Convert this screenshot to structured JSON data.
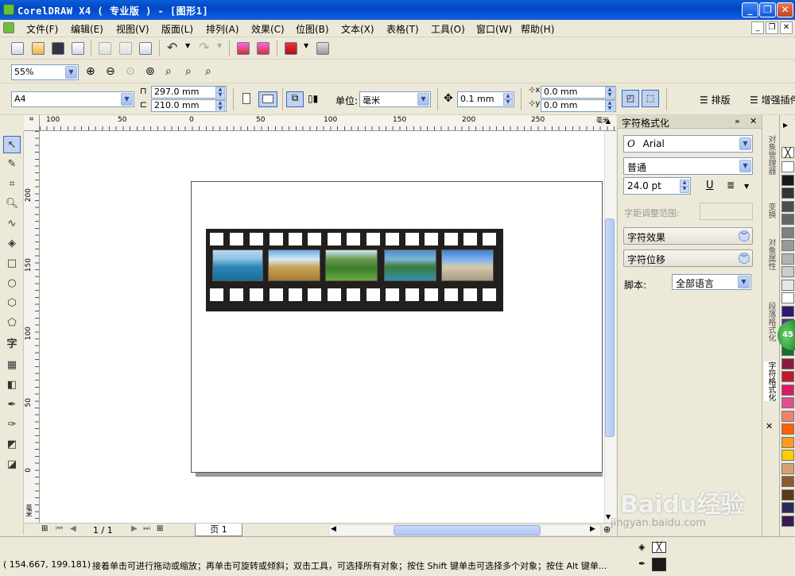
{
  "window": {
    "title": "CorelDRAW X4 ( 专业版 ) - [图形1]",
    "minimize": "_",
    "restore": "❐",
    "close": "✕"
  },
  "menu": {
    "items": [
      "文件(F)",
      "编辑(E)",
      "视图(V)",
      "版面(L)",
      "排列(A)",
      "效果(C)",
      "位图(B)",
      "文本(X)",
      "表格(T)",
      "工具(O)",
      "窗口(W)",
      "帮助(H)"
    ],
    "doc_controls": [
      "_",
      "❐",
      "✕"
    ]
  },
  "zoombar": {
    "zoom_value": "55%"
  },
  "propertybar": {
    "page_size": "A4",
    "width": "297.0 mm",
    "height": "210.0 mm",
    "unit_label": "单位:",
    "unit_value": "毫米",
    "nudge": "0.1 mm",
    "dup_x": "0.0 mm",
    "dup_y": "0.0 mm",
    "layout_label": "排版",
    "enhance_label": "增强插件"
  },
  "ruler": {
    "h_ticks": [
      "100",
      "50",
      "0",
      "50",
      "100",
      "150",
      "200",
      "250",
      "毫米"
    ],
    "v_ticks": [
      "200",
      "150",
      "100",
      "50",
      "0",
      "毫米"
    ]
  },
  "pagenav": {
    "counter": "1 / 1",
    "tab": "页 1"
  },
  "docker": {
    "title": "字符格式化",
    "font": "Arial",
    "style": "普通",
    "size": "24.0 pt",
    "kerning_label": "字距调整范围:",
    "effects_label": "字符效果",
    "shift_label": "字符位移",
    "script_label": "脚本:",
    "script_value": "全部语言",
    "vtabs": [
      "对象管理器",
      "变换",
      "对象属性",
      "段落格式化",
      "字符格式化"
    ]
  },
  "palette": {
    "colors": [
      "#ffffff",
      "#1a1a1a",
      "#333333",
      "#4d4d4d",
      "#666666",
      "#808080",
      "#999999",
      "#b3b3b3",
      "#cccccc",
      "#e6e6e6",
      "#ffffff",
      "#2e1a6e",
      "#5a2d91",
      "#0a8a3a",
      "#0f6f2f",
      "#8a1a3a",
      "#c01830",
      "#d81a6a",
      "#e05090",
      "#f08070",
      "#ff6000",
      "#ff9a20",
      "#ffcc00",
      "#d8a070",
      "#8a5a30",
      "#5a3a1a",
      "#2a2a5a",
      "#3a1a50"
    ]
  },
  "status": {
    "coords": "( 154.667, 199.181)",
    "message": "接着单击可进行拖动或缩放；再单击可旋转或倾斜；双击工具，可选择所有对象；按住 Shift 键单击可选择多个对象；按住 Alt 键单..."
  },
  "watermark": {
    "brand": "Baidu经验",
    "url": "jingyan.baidu.com"
  }
}
